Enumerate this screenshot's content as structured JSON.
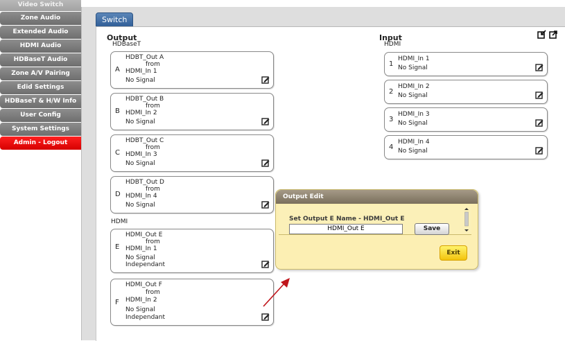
{
  "sidebar": {
    "items": [
      {
        "label": "Video Switch"
      },
      {
        "label": "Zone Audio"
      },
      {
        "label": "Extended Audio"
      },
      {
        "label": "HDMI Audio"
      },
      {
        "label": "HDBaseT Audio"
      },
      {
        "label": "Zone A/V Pairing"
      },
      {
        "label": "Edid Settings"
      },
      {
        "label": "HDBaseT & H/W Info"
      },
      {
        "label": "User Config"
      },
      {
        "label": "System Settings"
      },
      {
        "label": "Admin - Logout"
      }
    ]
  },
  "tab": {
    "label": "Switch"
  },
  "output": {
    "title": "Output",
    "hdbaset_label": "HDBaseT",
    "hdmi_label": "HDMI",
    "cards": [
      {
        "letter": "A",
        "name": "HDBT_Out A",
        "from": "from",
        "source": "HDMI_In 1",
        "status": "No Signal"
      },
      {
        "letter": "B",
        "name": "HDBT_Out B",
        "from": "from",
        "source": "HDMI_In 2",
        "status": "No Signal"
      },
      {
        "letter": "C",
        "name": "HDBT_Out C",
        "from": "from",
        "source": "HDMI_In 3",
        "status": "No Signal"
      },
      {
        "letter": "D",
        "name": "HDBT_Out D",
        "from": "from",
        "source": "HDMI_In 4",
        "status": "No Signal"
      },
      {
        "letter": "E",
        "name": "HDMI_Out E",
        "from": "from",
        "source": "HDMI_In 1",
        "status": "No Signal",
        "mode": "Independant"
      },
      {
        "letter": "F",
        "name": "HDMI_Out F",
        "from": "from",
        "source": "HDMI_In 2",
        "status": "No Signal",
        "mode": "Independant"
      }
    ]
  },
  "input": {
    "title": "Input",
    "hdmi_label": "HDMI",
    "cards": [
      {
        "number": "1",
        "name": "HDMI_In 1",
        "status": "No Signal"
      },
      {
        "number": "2",
        "name": "HDMI_In 2",
        "status": "No Signal"
      },
      {
        "number": "3",
        "name": "HDMI_In 3",
        "status": "No Signal"
      },
      {
        "number": "4",
        "name": "HDMI_In 4",
        "status": "No Signal"
      }
    ]
  },
  "dialog": {
    "title": "Output Edit",
    "label": "Set Output E Name - HDMI_Out E",
    "input_value": "HDMI_Out E",
    "save_label": "Save",
    "exit_label": "Exit"
  },
  "colors": {
    "tab": "#2f5d96",
    "logout": "#e00000",
    "dialog_bg": "#fcefb3",
    "exit_button": "#f3c30d",
    "arrow": "#c0151b"
  }
}
